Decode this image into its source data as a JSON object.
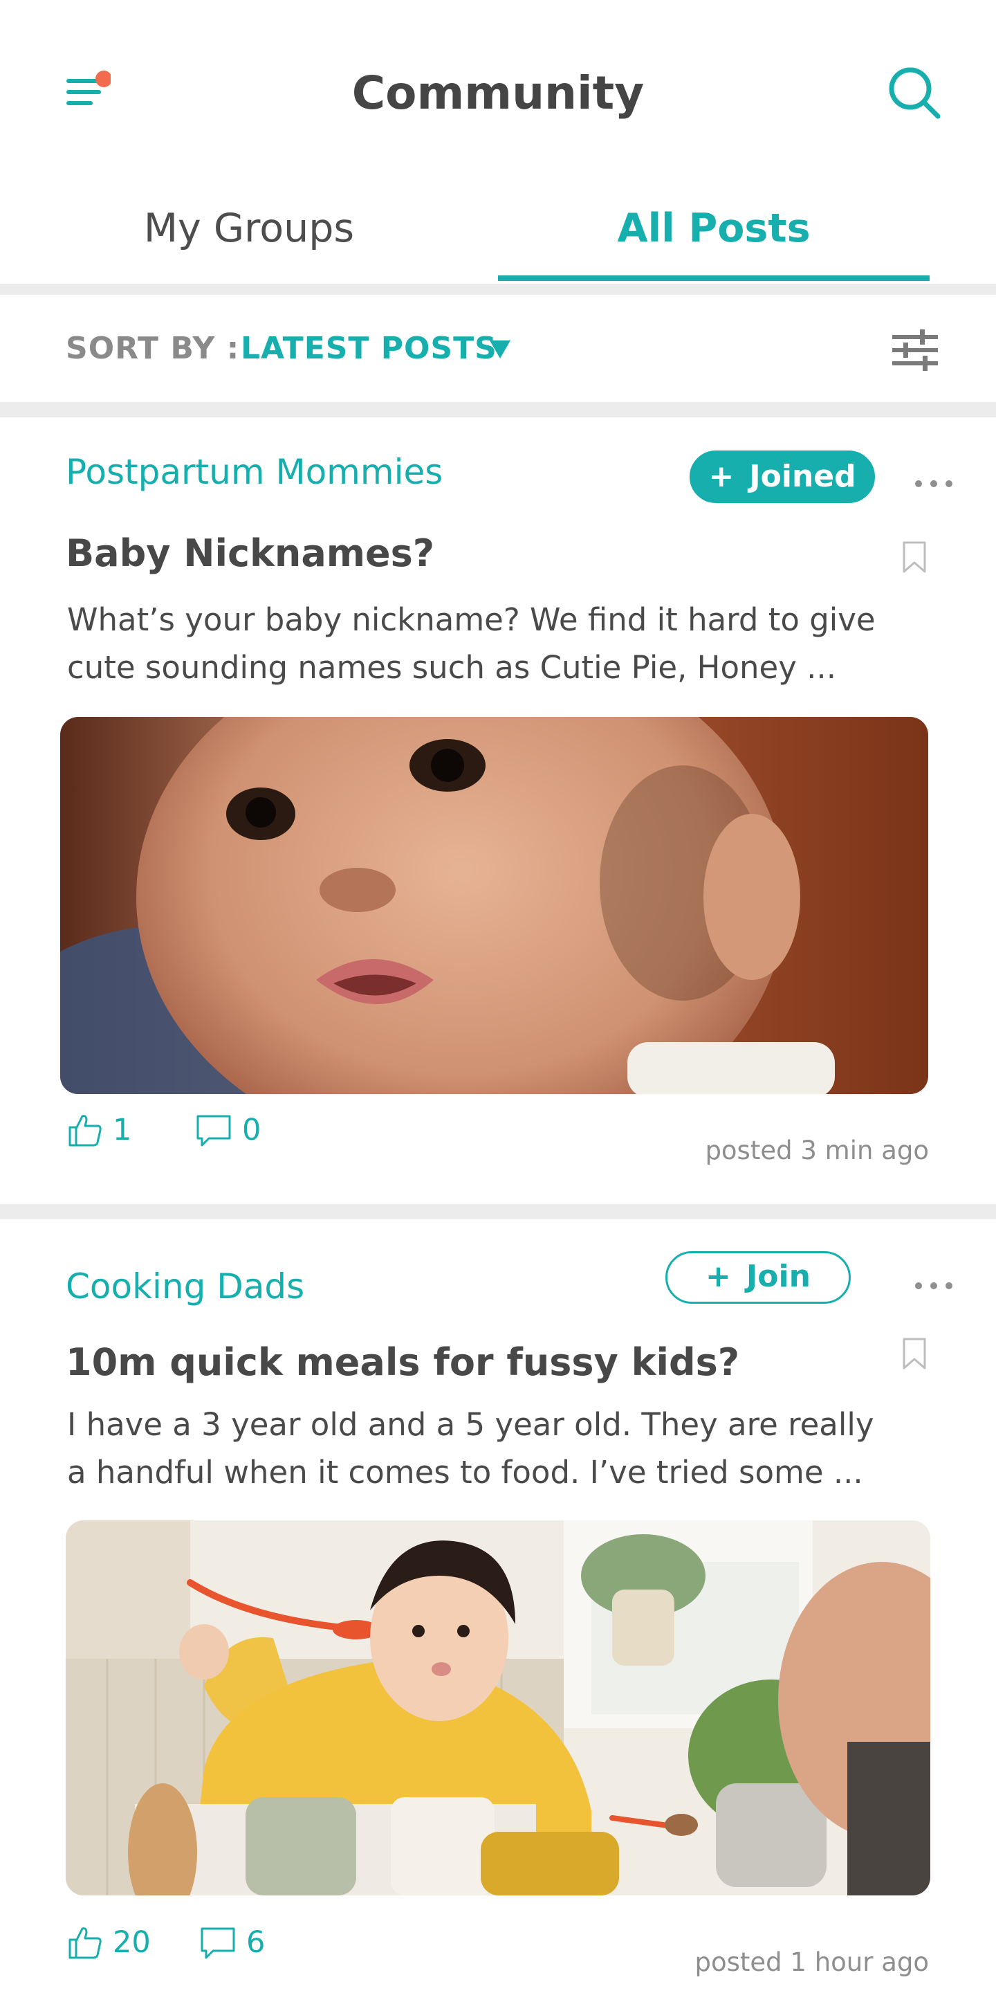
{
  "header": {
    "title": "Community",
    "menu_icon": "hamburger-menu-icon",
    "notification_dot_color": "#f26b4f",
    "search_icon": "search-icon"
  },
  "tabs": [
    {
      "label": "My Groups",
      "active": false
    },
    {
      "label": "All Posts",
      "active": true
    }
  ],
  "sort": {
    "label": "SORT BY :",
    "value": "LATEST POSTS",
    "caret_icon": "caret-down-icon",
    "filter_icon": "filter-sliders-icon"
  },
  "colors": {
    "accent": "#17aeae",
    "text": "#4a4a4a",
    "muted": "#8e8e8e",
    "separator": "#ececec"
  },
  "posts": [
    {
      "group": "Postpartum Mommies",
      "join_label": "Joined",
      "joined": true,
      "title": "Baby Nicknames?",
      "excerpt_line1": "What’s your baby nickname? We find it hard to give",
      "excerpt_line2": "cute sounding names such as Cutie Pie, Honey ...",
      "likes": "1",
      "comments": "0",
      "timestamp": "posted 3 min ago"
    },
    {
      "group": "Cooking Dads",
      "join_label": "Join",
      "joined": false,
      "title": "10m quick meals for fussy kids?",
      "excerpt_line1": "I have a 3 year old and a 5 year old. They are really",
      "excerpt_line2": "a handful when it comes to food. I’ve tried some ...",
      "likes": "20",
      "comments": "6",
      "timestamp": "posted 1 hour ago"
    }
  ]
}
